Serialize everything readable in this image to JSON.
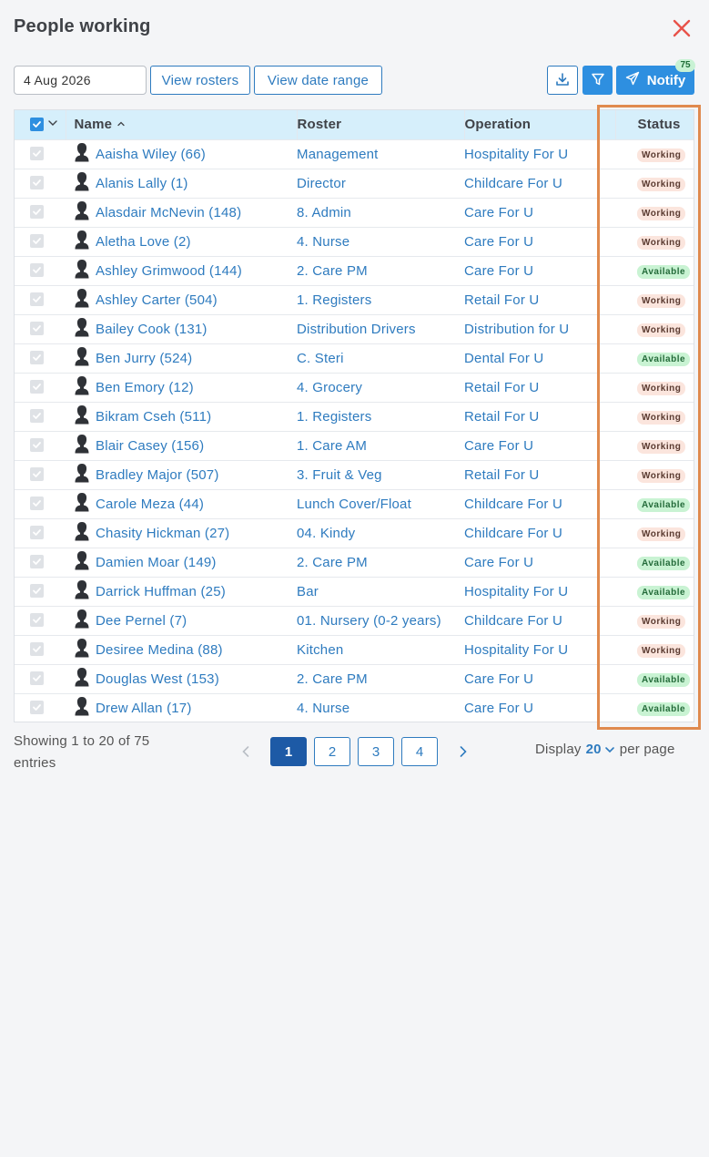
{
  "header": {
    "title": "People working"
  },
  "toolbar": {
    "date_value": "4 Aug 2026",
    "view_rosters": "View rosters",
    "view_date_range": "View date range",
    "notify_label": "Notify",
    "notify_count": "75"
  },
  "table": {
    "columns": {
      "name": "Name",
      "roster": "Roster",
      "operation": "Operation",
      "status": "Status"
    },
    "rows": [
      {
        "name": "Aaisha Wiley (66)",
        "roster": "Management",
        "operation": "Hospitality For U",
        "status": "Working"
      },
      {
        "name": "Alanis Lally (1)",
        "roster": "Director",
        "operation": "Childcare For U",
        "status": "Working"
      },
      {
        "name": "Alasdair McNevin (148)",
        "roster": "8. Admin",
        "operation": "Care For U",
        "status": "Working"
      },
      {
        "name": "Aletha Love (2)",
        "roster": "4. Nurse",
        "operation": "Care For U",
        "status": "Working"
      },
      {
        "name": "Ashley Grimwood (144)",
        "roster": "2. Care PM",
        "operation": "Care For U",
        "status": "Available"
      },
      {
        "name": "Ashley Carter (504)",
        "roster": "1. Registers",
        "operation": "Retail For U",
        "status": "Working"
      },
      {
        "name": "Bailey Cook (131)",
        "roster": "Distribution Drivers",
        "operation": "Distribution for U",
        "status": "Working"
      },
      {
        "name": "Ben Jurry (524)",
        "roster": "C. Steri",
        "operation": "Dental For U",
        "status": "Available"
      },
      {
        "name": "Ben Emory (12)",
        "roster": "4. Grocery",
        "operation": "Retail For U",
        "status": "Working"
      },
      {
        "name": "Bikram Cseh (511)",
        "roster": "1. Registers",
        "operation": "Retail For U",
        "status": "Working"
      },
      {
        "name": "Blair Casey (156)",
        "roster": "1. Care AM",
        "operation": "Care For U",
        "status": "Working"
      },
      {
        "name": "Bradley Major (507)",
        "roster": "3. Fruit & Veg",
        "operation": "Retail For U",
        "status": "Working"
      },
      {
        "name": "Carole Meza (44)",
        "roster": "Lunch Cover/Float",
        "operation": "Childcare For U",
        "status": "Available"
      },
      {
        "name": "Chasity Hickman (27)",
        "roster": "04. Kindy",
        "operation": "Childcare For U",
        "status": "Working"
      },
      {
        "name": "Damien Moar (149)",
        "roster": "2. Care PM",
        "operation": "Care For U",
        "status": "Available"
      },
      {
        "name": "Darrick Huffman (25)",
        "roster": "Bar",
        "operation": "Hospitality For U",
        "status": "Available"
      },
      {
        "name": "Dee Pernel (7)",
        "roster": "01. Nursery (0-2 years)",
        "operation": "Childcare For U",
        "status": "Working"
      },
      {
        "name": "Desiree Medina (88)",
        "roster": "Kitchen",
        "operation": "Hospitality For U",
        "status": "Working"
      },
      {
        "name": "Douglas West (153)",
        "roster": "2. Care PM",
        "operation": "Care For U",
        "status": "Available"
      },
      {
        "name": "Drew Allan (17)",
        "roster": "4. Nurse",
        "operation": "Care For U",
        "status": "Available"
      }
    ]
  },
  "footer": {
    "showing": "Showing 1 to 20 of 75 entries",
    "pages": [
      "1",
      "2",
      "3",
      "4"
    ],
    "display_label": "Display",
    "display_value": "20",
    "per_page_label": "per page"
  },
  "colors": {
    "accent": "#2e8fe0",
    "link": "#2e7bbf",
    "working_badge": "#fbe5dd",
    "available_badge": "#c9f3d3",
    "highlight": "#e08a4e",
    "close": "#e8524a"
  },
  "icons": [
    "close-icon",
    "download-icon",
    "filter-icon",
    "send-icon",
    "sort-up-icon",
    "chevron-down-icon",
    "person-silhouette-icon",
    "chevron-left-icon",
    "chevron-right-icon",
    "checkmark-icon"
  ]
}
